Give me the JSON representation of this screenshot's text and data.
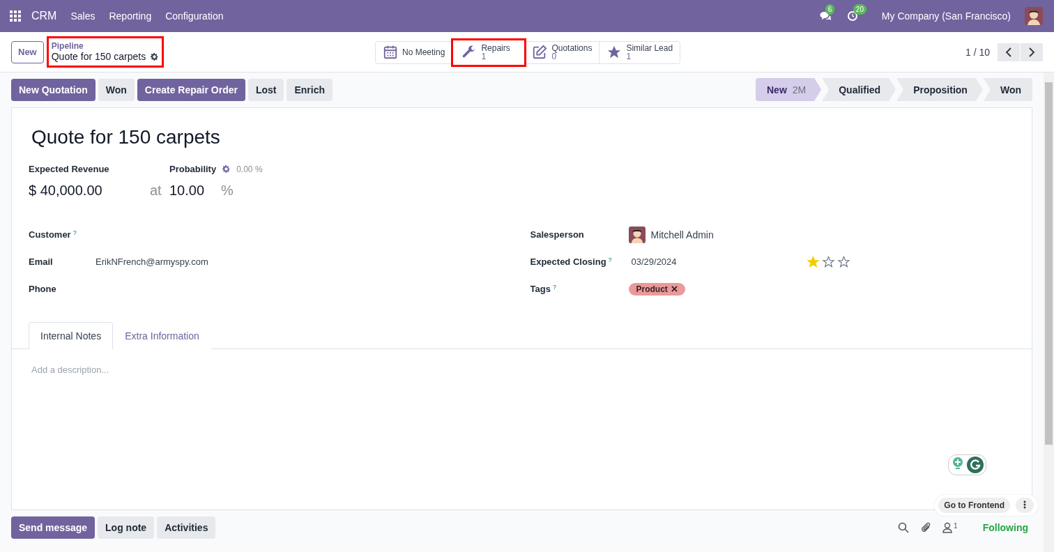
{
  "navbar": {
    "app": "CRM",
    "menus": [
      "Sales",
      "Reporting",
      "Configuration"
    ],
    "messages_badge": "6",
    "activities_badge": "20",
    "company": "My Company (San Francisco)"
  },
  "control_panel": {
    "new_button": "New",
    "breadcrumb": {
      "parent": "Pipeline",
      "current": "Quote for 150 carpets",
      "highlighted": true
    },
    "smart_buttons": [
      {
        "label": "No Meeting",
        "highlighted": false
      },
      {
        "label": "Repairs",
        "value": "1",
        "highlighted": true
      },
      {
        "label": "Quotations",
        "value": "0",
        "highlighted": false
      },
      {
        "label": "Similar Lead",
        "value": "1",
        "highlighted": false
      }
    ],
    "pager": "1 / 10"
  },
  "actions": [
    {
      "label": "New Quotation",
      "primary": true
    },
    {
      "label": "Won",
      "primary": false
    },
    {
      "label": "Create Repair Order",
      "primary": true
    },
    {
      "label": "Lost",
      "primary": false
    },
    {
      "label": "Enrich",
      "primary": false
    }
  ],
  "stages": [
    {
      "label": "New",
      "duration": "2M",
      "selected": true
    },
    {
      "label": "Qualified",
      "selected": false
    },
    {
      "label": "Proposition",
      "selected": false
    },
    {
      "label": "Won",
      "selected": false
    }
  ],
  "form": {
    "title": "Quote for 150 carpets",
    "revenue": {
      "label": "Expected Revenue",
      "value": "$ 40,000.00",
      "at": "at"
    },
    "probability": {
      "label": "Probability",
      "automated": "0.00 %",
      "value": "10.00",
      "unit": "%"
    },
    "left_fields": [
      {
        "label": "Customer",
        "help": "?"
      },
      {
        "label": "Email",
        "value": "ErikNFrench@armyspy.com"
      },
      {
        "label": "Phone"
      }
    ],
    "salesperson": {
      "label": "Salesperson",
      "value": "Mitchell Admin"
    },
    "expected_closing": {
      "label": "Expected Closing",
      "help": "?",
      "value": "03/29/2024",
      "stars": 1
    },
    "tags": {
      "label": "Tags",
      "help": "?",
      "items": [
        {
          "label": "Product",
          "color": "#e99a9a"
        }
      ]
    },
    "tabs": [
      {
        "label": "Internal Notes",
        "selected": true
      },
      {
        "label": "Extra Information",
        "selected": false
      }
    ],
    "description_placeholder": "Add a description..."
  },
  "overlay": {
    "go_to_frontend": "Go to Frontend"
  },
  "chatter": {
    "buttons": [
      {
        "label": "Send message",
        "primary": true
      },
      {
        "label": "Log note",
        "primary": false
      },
      {
        "label": "Activities",
        "primary": false
      }
    ],
    "followers_count": "1",
    "following": "Following"
  }
}
